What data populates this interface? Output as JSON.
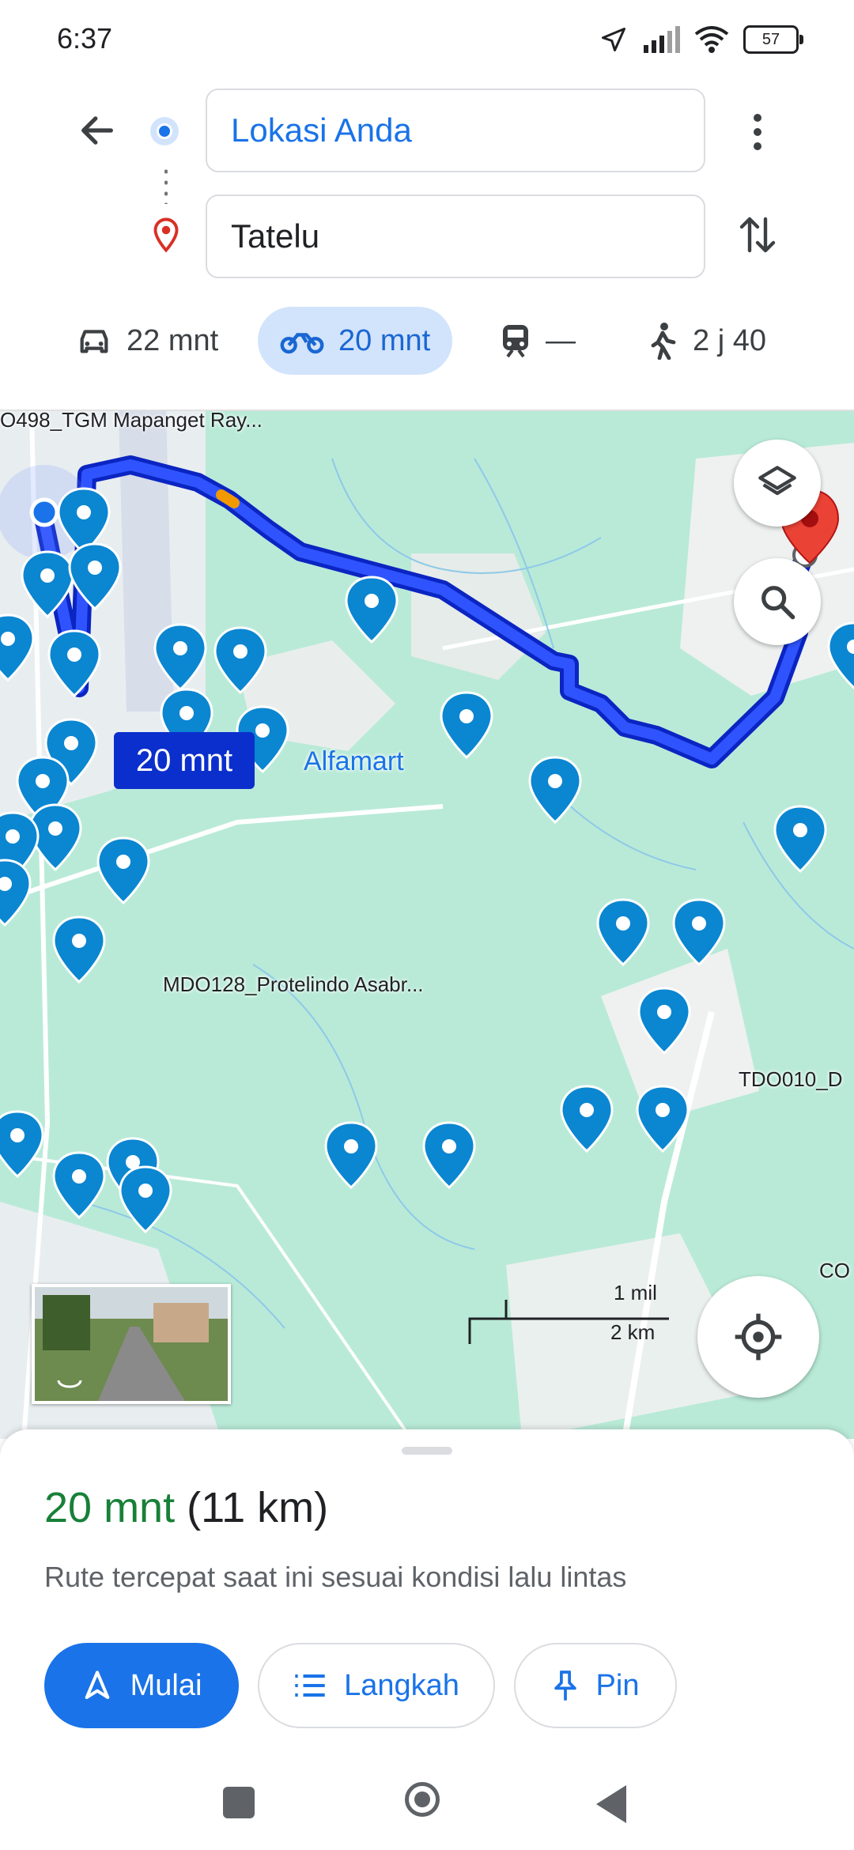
{
  "status_bar": {
    "time": "6:37",
    "battery": "57"
  },
  "directions": {
    "origin": "Lokasi Anda",
    "destination": "Tatelu"
  },
  "modes": [
    {
      "icon": "car-icon",
      "label": "22 mnt",
      "active": false
    },
    {
      "icon": "motorcycle-icon",
      "label": "20 mnt",
      "active": true
    },
    {
      "icon": "train-icon",
      "label": "—",
      "active": false
    },
    {
      "icon": "walk-icon",
      "label": "2 j 40",
      "active": false
    }
  ],
  "map": {
    "labels": {
      "top": "O498_TGM Mapanget Ray...",
      "protelindo": "MDO128_Protelindo Asabr...",
      "tdo": "TDO010_D",
      "co": "CO",
      "alfamart": "Alfamart"
    },
    "route_badge": "20 mnt",
    "scale": {
      "miles": "1 mil",
      "km": "2 km"
    },
    "route_color": "#1a3ff0"
  },
  "summary": {
    "time": "20 mnt",
    "distance": "(11 km)",
    "description": "Rute tercepat saat ini sesuai kondisi lalu lintas"
  },
  "actions": {
    "start": "Mulai",
    "steps": "Langkah",
    "pin": "Pin"
  },
  "colors": {
    "accent": "#1a73e8",
    "eta_green": "#188038",
    "map_green": "#b9ead8"
  }
}
